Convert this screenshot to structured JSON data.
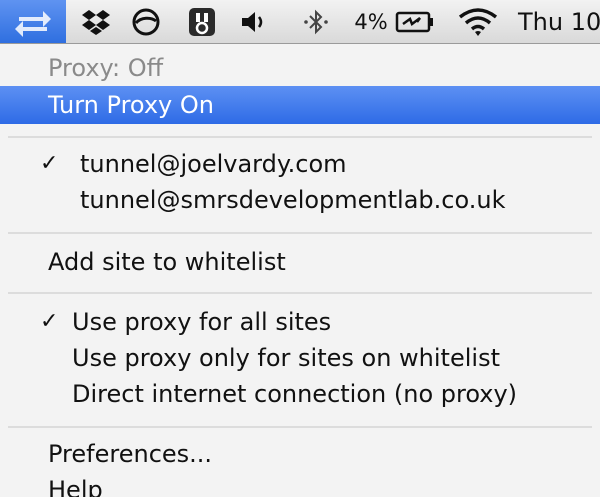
{
  "menubar": {
    "icons": [
      {
        "name": "proxy-switch-icon",
        "active": true
      },
      {
        "name": "dropbox-icon"
      },
      {
        "name": "circle-slash-icon"
      },
      {
        "name": "owl-app-icon"
      },
      {
        "name": "volume-icon"
      },
      {
        "name": "bluetooth-icon"
      },
      {
        "name": "battery-charging-icon"
      },
      {
        "name": "wifi-icon"
      }
    ],
    "battery_percent": "4%",
    "clock": "Thu 10"
  },
  "menu": {
    "status": "Proxy: Off",
    "turn_on": "Turn Proxy On",
    "accounts": [
      {
        "label": "tunnel@joelvardy.com",
        "checked": true
      },
      {
        "label": "tunnel@smrsdevelopmentlab.co.uk",
        "checked": false
      }
    ],
    "add_whitelist": "Add site to whitelist",
    "modes": [
      {
        "label": "Use proxy for all sites",
        "checked": true
      },
      {
        "label": "Use proxy only for sites on whitelist",
        "checked": false
      },
      {
        "label": "Direct internet connection (no proxy)",
        "checked": false
      }
    ],
    "preferences": "Preferences...",
    "help": "Help",
    "checkmark": "✓"
  },
  "colors": {
    "highlight": "#3a78ea",
    "disabled_text": "#8a8a8a",
    "menu_background": "#f3f3f3"
  }
}
